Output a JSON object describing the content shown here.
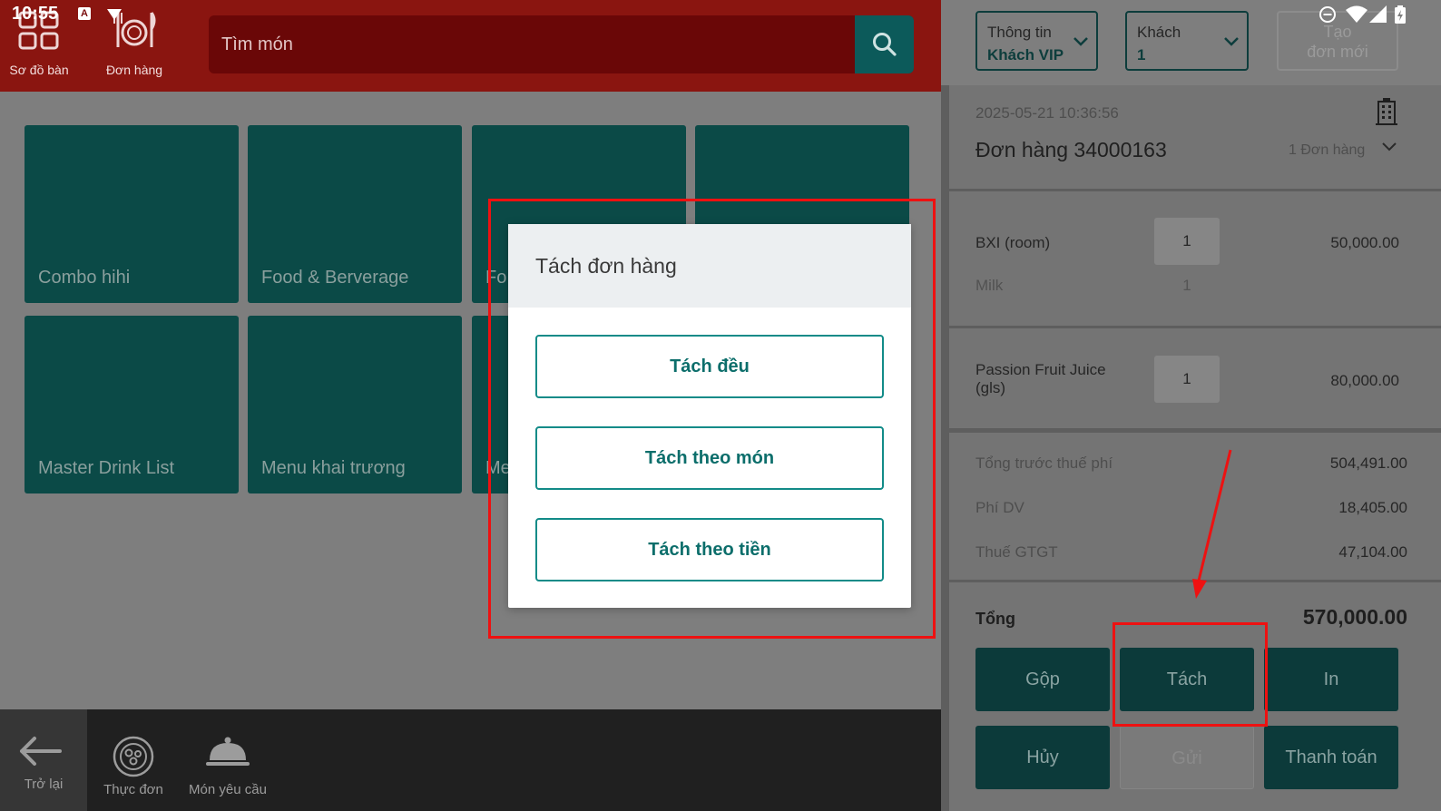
{
  "status": {
    "time": "10:55",
    "badge": "A"
  },
  "topbar": {
    "nav": [
      {
        "label": "Sơ đồ bàn",
        "icon": "grid-icon"
      },
      {
        "label": "Đơn hàng",
        "icon": "dish-icon"
      }
    ],
    "search": {
      "placeholder": "Tìm món",
      "icon": "search-icon"
    }
  },
  "menu": {
    "tiles": [
      {
        "name": "Combo hihi"
      },
      {
        "name": "Food & Berverage"
      },
      {
        "name": "Fo"
      },
      {
        "name": ""
      },
      {
        "name": "Master Drink List"
      },
      {
        "name": "Menu khai trương"
      },
      {
        "name": "Me"
      }
    ]
  },
  "bottombar": {
    "back": {
      "label": "Trở lại",
      "icon": "arrow-left-icon"
    },
    "items": [
      {
        "label": "Thực đơn",
        "icon": "menu-plate-icon"
      },
      {
        "label": "Món yêu cầu",
        "icon": "cloche-icon"
      }
    ]
  },
  "right": {
    "customer_info": {
      "line1": "Thông tin",
      "line2": "Khách VIP"
    },
    "guests": {
      "line1": "Khách",
      "line2": "1"
    },
    "new_order": {
      "line1": "Tạo",
      "line2": "đơn mới"
    },
    "order": {
      "datetime": "2025-05-21 10:36:56",
      "title": "Đơn hàng 34000163",
      "count": "1 Đơn hàng"
    },
    "items": [
      {
        "name": "BXI (room)",
        "qty": "1",
        "price": "50,000.00",
        "sub_name": "Milk",
        "sub_qty": "1"
      },
      {
        "name": "Passion Fruit Juice (gls)",
        "qty": "1",
        "price": "80,000.00"
      }
    ],
    "summary": [
      {
        "label": "Tổng trước thuế phí",
        "value": "504,491.00"
      },
      {
        "label": "Phí DV",
        "value": "18,405.00"
      },
      {
        "label": "Thuế GTGT",
        "value": "47,104.00"
      }
    ],
    "total": {
      "label": "Tổng",
      "value": "570,000.00"
    },
    "actions": {
      "merge": "Gộp",
      "split": "Tách",
      "print": "In",
      "cancel": "Hủy",
      "send": "Gửi",
      "pay": "Thanh toán"
    }
  },
  "modal": {
    "title": "Tách đơn hàng",
    "options": [
      "Tách đều",
      "Tách theo món",
      "Tách theo tiền"
    ]
  },
  "colors": {
    "topbar": "#8a1510",
    "teal": "#128b88",
    "annotation": "#ee1111"
  }
}
